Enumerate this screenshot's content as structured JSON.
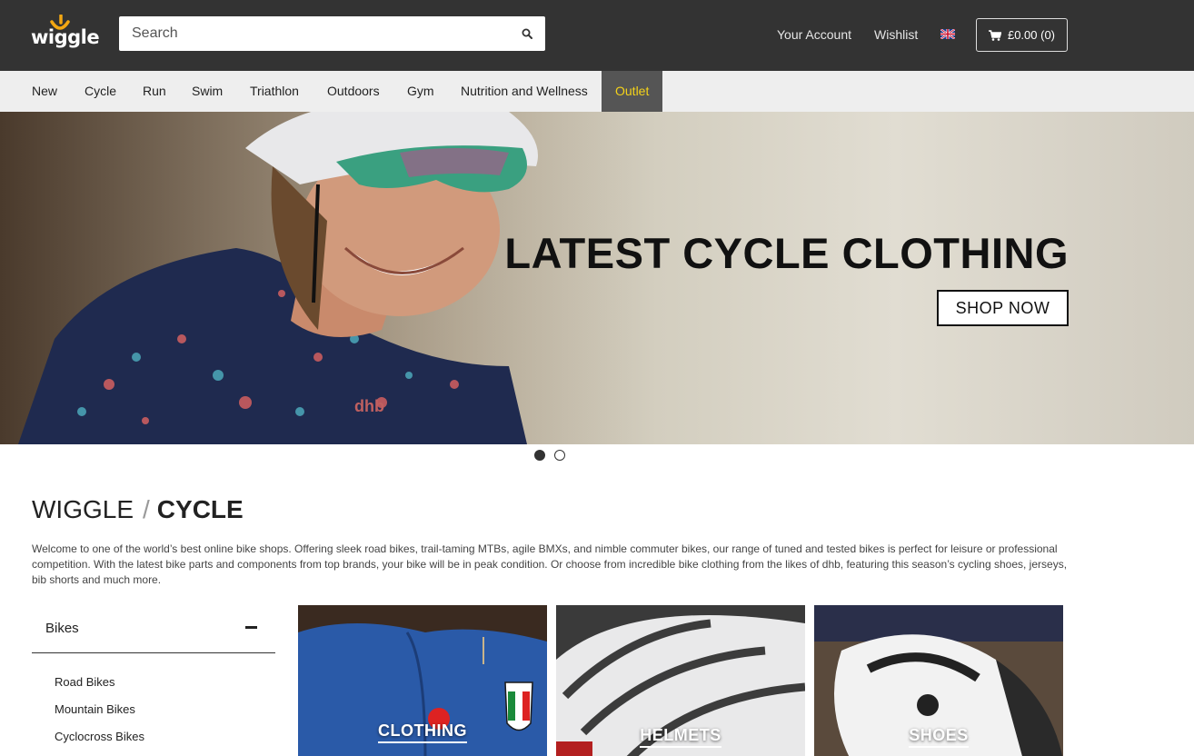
{
  "header": {
    "logo_text": "wiggle",
    "search_placeholder": "Search",
    "links": {
      "account": "Your Account",
      "wishlist": "Wishlist"
    },
    "basket_label": "£0.00 (0)",
    "icons": {
      "search": "search-icon",
      "cart": "cart-icon",
      "flag": "uk-flag-icon"
    }
  },
  "nav": {
    "items": [
      "New",
      "Cycle",
      "Run",
      "Swim",
      "Triathlon",
      "Outdoors",
      "Gym",
      "Nutrition and Wellness"
    ],
    "outlet": "Outlet",
    "outlet_color": "#f4d21a"
  },
  "hero": {
    "title": "LATEST CYCLE CLOTHING",
    "cta": "SHOP NOW",
    "slides_total": 2,
    "active_slide": 1
  },
  "breadcrumb": {
    "root": "WIGGLE",
    "separator": "/",
    "current": "CYCLE"
  },
  "intro": "Welcome to one of the world’s best online bike shops. Offering sleek road bikes, trail-taming MTBs, agile BMXs, and nimble commuter bikes, our range of tuned and tested bikes is perfect for leisure or professional competition. With the latest bike parts and components from top brands, your bike will be in peak condition. Or choose from incredible bike clothing from the likes of dhb, featuring this season’s cycling shoes, jerseys, bib shorts and much more.",
  "sidebar": {
    "title": "Bikes",
    "items": [
      "Road Bikes",
      "Mountain Bikes",
      "Cyclocross Bikes"
    ]
  },
  "tiles": [
    "CLOTHING",
    "HELMETS",
    "SHOES"
  ],
  "colors": {
    "header_bg": "#333333",
    "nav_bg": "#eeeeee",
    "outlet_bg": "#555555"
  }
}
